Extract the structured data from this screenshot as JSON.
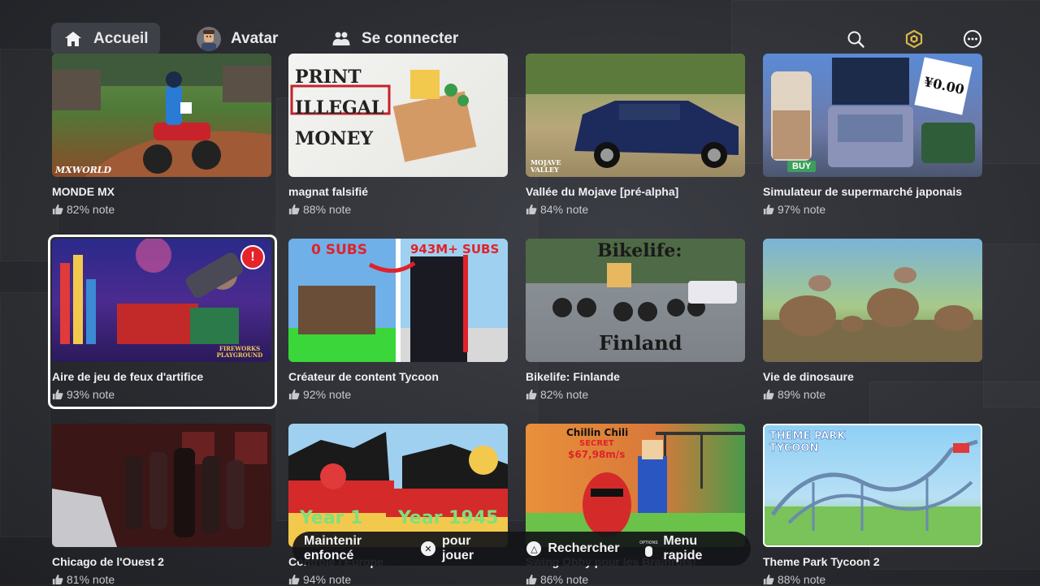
{
  "nav": {
    "home_label": "Accueil",
    "avatar_label": "Avatar",
    "connect_label": "Se connecter",
    "icons": [
      "home-icon",
      "avatar-icon",
      "people-icon",
      "search-icon",
      "robux-icon",
      "more-icon"
    ]
  },
  "games": [
    {
      "title": "MONDE MX",
      "rating": "82% note",
      "thumb_text": "MXWORLD"
    },
    {
      "title": "magnat falsifié",
      "rating": "88% note",
      "thumb_text": "PRINT ILLEGAL MONEY"
    },
    {
      "title": "Vallée du Mojave [pré-alpha]",
      "rating": "84% note",
      "thumb_text": "MOJAVE VALLEY"
    },
    {
      "title": "Simulateur de supermarché japonais",
      "rating": "97% note",
      "thumb_text": "¥0.00",
      "thumb_sub": "BUY"
    },
    {
      "title": "Aire de jeu de feux d'artifice",
      "rating": "93% note",
      "thumb_text": "FIREWORKS PLAYGROUND"
    },
    {
      "title": "Créateur de content Tycoon",
      "rating": "92% note",
      "thumb_text": "0 SUBS",
      "thumb_sub": "943M+ SUBS"
    },
    {
      "title": "Bikelife: Finlande",
      "rating": "82% note",
      "thumb_text": "Bikelife:",
      "thumb_sub": "Finland"
    },
    {
      "title": "Vie de dinosaure",
      "rating": "89% note"
    },
    {
      "title": "Chicago de l'Ouest 2",
      "rating": "81% note"
    },
    {
      "title": "Contrôle l'Europe",
      "rating": "94% note",
      "thumb_text": "Year 1",
      "thumb_sub": "Year 1945"
    },
    {
      "title": "Swing Obby pour les Brainrots!",
      "rating": "86% note",
      "thumb_text": "Chillin Chili",
      "thumb_sub": "SECRET",
      "thumb_sub2": "$67,98m/s"
    },
    {
      "title": "Theme Park Tycoon 2",
      "rating": "88% note",
      "thumb_text": "THEME PARK TYCOON"
    }
  ],
  "hint_bar": {
    "hold_label": "Maintenir enfoncé",
    "play_label": "pour jouer",
    "search_label": "Rechercher",
    "options_caption": "OPTIONS",
    "quick_menu_label": "Menu rapide"
  },
  "colors": {
    "focus": "#ffffff",
    "alert": "#e3242b",
    "robux": "#d9b64a"
  }
}
